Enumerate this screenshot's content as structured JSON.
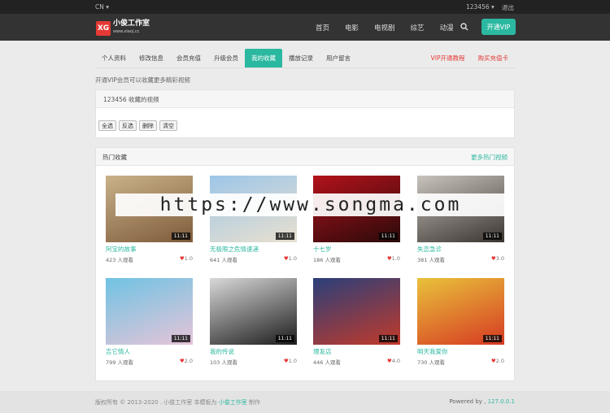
{
  "topbar": {
    "lang": "CN ▾",
    "user": "123456 ▾",
    "logout": "退出"
  },
  "navbar": {
    "logo_mark": "XG",
    "logo_text": "小俊工作室",
    "logo_sub": "www.xiaoj.cc",
    "links": [
      "首页",
      "电影",
      "电视剧",
      "综艺",
      "动漫"
    ],
    "vip_button": "开通VIP"
  },
  "tabs": [
    {
      "label": "个人资料"
    },
    {
      "label": "修改信息"
    },
    {
      "label": "会员充值"
    },
    {
      "label": "升级会员"
    },
    {
      "label": "我的收藏"
    },
    {
      "label": "播放记录"
    },
    {
      "label": "用户留言"
    }
  ],
  "tabs_right": [
    "VIP开通教程",
    "购买充值卡"
  ],
  "notice": "开通VIP会员可以收藏更多精彩视频",
  "favorites": {
    "title": "123456 收藏的视频",
    "buttons": [
      "全选",
      "反选",
      "删除",
      "清空"
    ]
  },
  "hot": {
    "title": "热门收藏",
    "more": "更多热门视频",
    "items": [
      {
        "title": "阿宝的故事",
        "views": "423 人观看",
        "likes": "1.0",
        "badge": "11:11",
        "colors": [
          "#c9b28a",
          "#7e5b3a"
        ]
      },
      {
        "title": "无极限之危情速递",
        "views": "641 人观看",
        "likes": "1.0",
        "badge": "11:11",
        "colors": [
          "#9ec6e8",
          "#e8e0cf"
        ]
      },
      {
        "title": "十七岁",
        "views": "186 人观看",
        "likes": "1.0",
        "badge": "11:11",
        "colors": [
          "#b3121b",
          "#2a0a0a"
        ]
      },
      {
        "title": "失恋急诊",
        "views": "381 人观看",
        "likes": "3.0",
        "badge": "11:11",
        "colors": [
          "#c9c3bd",
          "#3a3530"
        ]
      },
      {
        "title": "吉它情人",
        "views": "799 人观看",
        "likes": "2.0",
        "badge": "11:11",
        "colors": [
          "#6fc3e3",
          "#e6c4d8"
        ]
      },
      {
        "title": "我的传说",
        "views": "103 人观看",
        "likes": "1.0",
        "badge": "11:11",
        "colors": [
          "#d9d9d9",
          "#1c1c1c"
        ]
      },
      {
        "title": "理发店",
        "views": "446 人观看",
        "likes": "4.0",
        "badge": "11:11",
        "colors": [
          "#2a3f7a",
          "#c23a2a"
        ]
      },
      {
        "title": "明天我爱你",
        "views": "730 人观看",
        "likes": "2.0",
        "badge": "11:11",
        "colors": [
          "#e9c23b",
          "#d63a22"
        ]
      }
    ]
  },
  "footer": {
    "copyright": "版权所有 © 2013-2020 . 小俊工作室 本模板为",
    "site": "小俊工作室",
    "tail": "制作",
    "powered": "Powered by ,",
    "ip": "127.0.0.1"
  },
  "watermark": "https://www.songma.com",
  "colors": {
    "accent": "#2bb8a0",
    "red": "#e53935",
    "dark": "#333333"
  }
}
